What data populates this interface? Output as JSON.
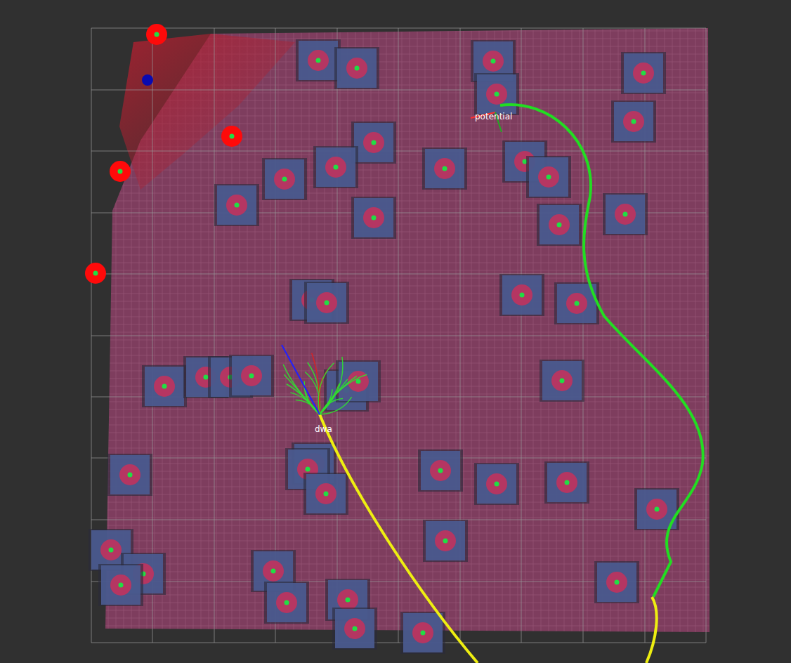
{
  "view": {
    "kind": "costmap-3d"
  },
  "frames": [
    {
      "label": "potential",
      "color": "#ff3030"
    },
    {
      "label": "dwa",
      "color": "#ffffff"
    }
  ],
  "paths": [
    {
      "name": "global-plan",
      "color": "#22dd22"
    },
    {
      "name": "local-plan",
      "color": "#eeee11"
    }
  ],
  "legend_markers": {
    "obstacle": "#c8305a",
    "laser": "#ff0a0a",
    "goal": "#0a0ab0"
  }
}
